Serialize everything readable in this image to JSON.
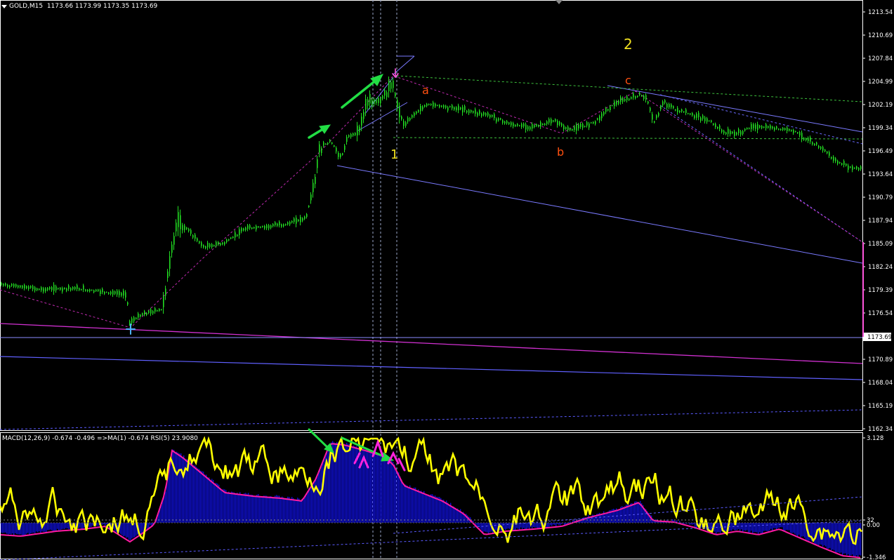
{
  "header": {
    "symbol": "GOLD,M15",
    "ohlc": "1173.66 1173.99 1173.35 1173.69"
  },
  "price_axis": {
    "ticks": [
      "1213.54",
      "1210.69",
      "1207.84",
      "1204.99",
      "1202.19",
      "1199.34",
      "1196.49",
      "1193.64",
      "1190.79",
      "1187.94",
      "1185.09",
      "1182.24",
      "1179.39",
      "1176.54",
      "1173.69",
      "1170.89",
      "1168.04",
      "1165.19",
      "1162.34"
    ],
    "current_price": "1173.69"
  },
  "indicator": {
    "label": "MACD(12,26,9) -0.674 -0.496  =>MA(1) -0.674  RSI(5) 23.9080",
    "ticks": [
      "3.128",
      "32",
      "0.00",
      "-1.346"
    ]
  },
  "wave_labels": [
    {
      "text": "1",
      "color": "#f0e020"
    },
    {
      "text": "2",
      "color": "#f0e020"
    },
    {
      "text": "a",
      "color": "#ff5010"
    },
    {
      "text": "b",
      "color": "#ff5010"
    },
    {
      "text": "c",
      "color": "#ff5010"
    }
  ],
  "colors": {
    "candle": "#22dd22",
    "macd_hist": "#1010d8",
    "macd_signal": "#ff1aa0",
    "rsi": "#ffff00",
    "arrow": "#22dd44",
    "trend_blue": "#7a7aff",
    "trend_magenta": "#d030d0"
  }
}
